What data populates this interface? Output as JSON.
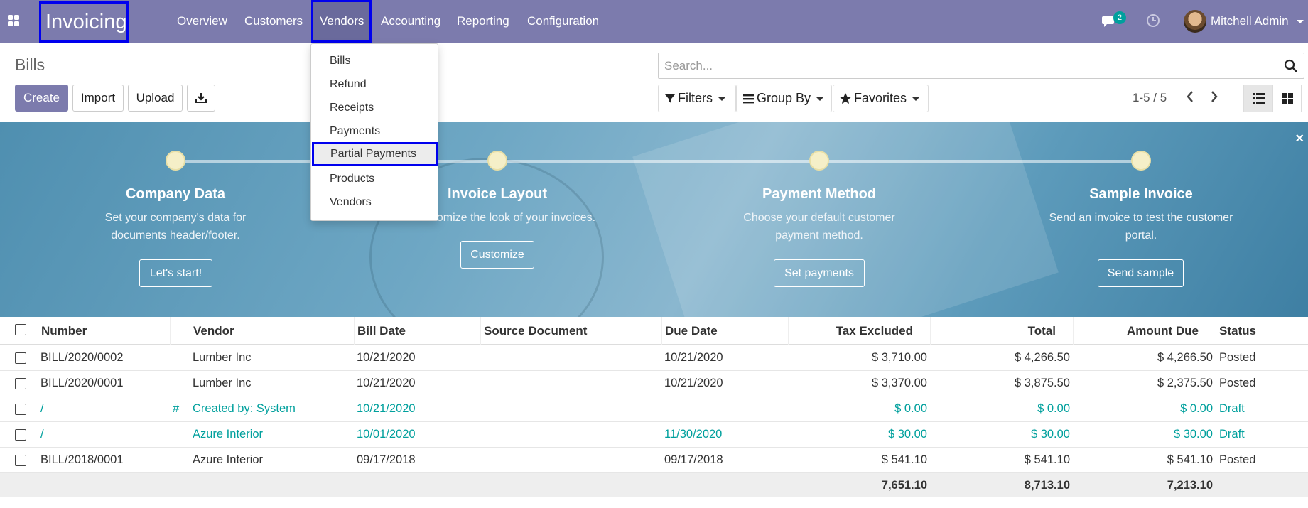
{
  "navbar": {
    "brand": "Invoicing",
    "menu": [
      {
        "label": "Overview"
      },
      {
        "label": "Customers"
      },
      {
        "label": "Vendors",
        "active": true
      },
      {
        "label": "Accounting"
      },
      {
        "label": "Reporting"
      },
      {
        "label": "Configuration"
      }
    ],
    "chat_badge": "2",
    "user_name": "Mitchell Admin",
    "icons": [
      "apps-grid-icon",
      "chat-icon",
      "clock-icon"
    ],
    "color": "#7c7bad"
  },
  "vendors_dropdown": {
    "items": [
      "Bills",
      "Refund",
      "Receipts",
      "Payments",
      "Partial Payments",
      "Products",
      "Vendors"
    ],
    "highlighted": "Partial Payments"
  },
  "control_panel": {
    "title": "Bills",
    "buttons": {
      "create": "Create",
      "import": "Import",
      "upload": "Upload"
    },
    "search_placeholder": "Search...",
    "filters": "Filters",
    "group_by": "Group By",
    "favorites": "Favorites",
    "pager": "1-5 / 5"
  },
  "onboarding": {
    "steps": [
      {
        "title": "Company Data",
        "description": "Set your company's data for documents header/footer.",
        "button": "Let's start!"
      },
      {
        "title": "Invoice Layout",
        "description": "Customize the look of your invoices.",
        "button": "Customize"
      },
      {
        "title": "Payment Method",
        "description": "Choose your default customer payment method.",
        "button": "Set payments"
      },
      {
        "title": "Sample Invoice",
        "description": "Send an invoice to test the customer portal.",
        "button": "Send sample"
      }
    ],
    "close": "×"
  },
  "table": {
    "headers": [
      "Number",
      "Vendor",
      "Bill Date",
      "Source Document",
      "Due Date",
      "Tax Excluded",
      "Total",
      "Amount Due",
      "Status"
    ],
    "rows": [
      {
        "number": "BILL/2020/0002",
        "hash": "",
        "vendor": "Lumber Inc",
        "bill_date": "10/21/2020",
        "source": "",
        "due_date": "10/21/2020",
        "tax_excluded": "$ 3,710.00",
        "total": "$ 4,266.50",
        "amount_due": "$ 4,266.50",
        "status": "Posted",
        "draft": false
      },
      {
        "number": "BILL/2020/0001",
        "hash": "",
        "vendor": "Lumber Inc",
        "bill_date": "10/21/2020",
        "source": "",
        "due_date": "10/21/2020",
        "tax_excluded": "$ 3,370.00",
        "total": "$ 3,875.50",
        "amount_due": "$ 2,375.50",
        "status": "Posted",
        "draft": false
      },
      {
        "number": "/",
        "hash": "#",
        "vendor": "Created by: System",
        "bill_date": "10/21/2020",
        "source": "",
        "due_date": "",
        "tax_excluded": "$ 0.00",
        "total": "$ 0.00",
        "amount_due": "$ 0.00",
        "status": "Draft",
        "draft": true
      },
      {
        "number": "/",
        "hash": "",
        "vendor": "Azure Interior",
        "bill_date": "10/01/2020",
        "source": "",
        "due_date": "11/30/2020",
        "tax_excluded": "$ 30.00",
        "total": "$ 30.00",
        "amount_due": "$ 30.00",
        "status": "Draft",
        "draft": true
      },
      {
        "number": "BILL/2018/0001",
        "hash": "",
        "vendor": "Azure Interior",
        "bill_date": "09/17/2018",
        "source": "",
        "due_date": "09/17/2018",
        "tax_excluded": "$ 541.10",
        "total": "$ 541.10",
        "amount_due": "$ 541.10",
        "status": "Posted",
        "draft": false
      }
    ],
    "totals": {
      "tax_excluded": "7,651.10",
      "total": "8,713.10",
      "amount_due": "7,213.10"
    }
  }
}
